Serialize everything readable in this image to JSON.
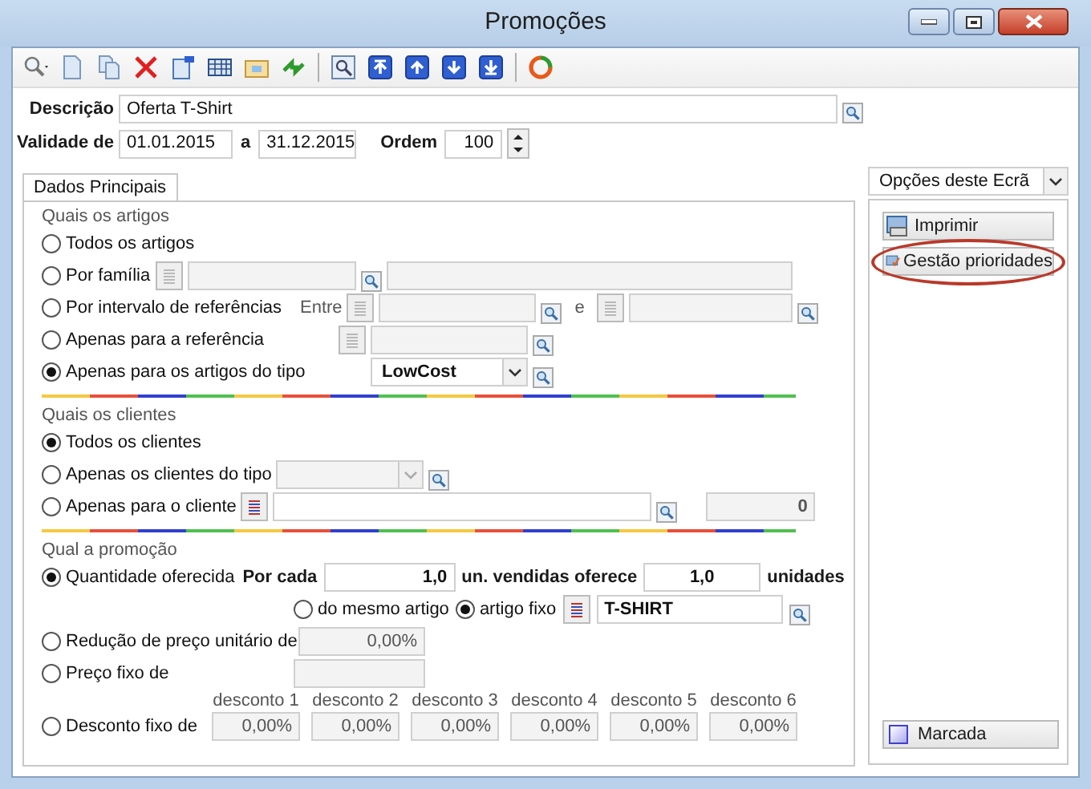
{
  "window": {
    "title": "Promoções"
  },
  "header": {
    "description": {
      "label": "Descrição",
      "value": "Oferta T-Shirt"
    },
    "validity": {
      "label": "Validade de",
      "from": "01.01.2015",
      "separator": "a",
      "to": "31.12.2015"
    },
    "order": {
      "label": "Ordem",
      "value": "100"
    }
  },
  "tabs": [
    {
      "label": "Dados Principais",
      "selected": true
    }
  ],
  "sections": [
    {
      "title": "Quais os artigos",
      "options": [
        {
          "kind": "plain",
          "label": "Todos os artigos",
          "selected": false
        },
        {
          "kind": "family",
          "label": "Por família",
          "selected": false
        },
        {
          "kind": "range",
          "label": "Por intervalo de referências",
          "between_label": "Entre",
          "and_label": "e",
          "selected": false
        },
        {
          "kind": "reference",
          "label": "Apenas para a referência",
          "selected": false
        },
        {
          "kind": "type",
          "label": "Apenas para os artigos do tipo",
          "value": "LowCost",
          "selected": true
        }
      ]
    },
    {
      "title": "Quais os clientes",
      "options": [
        {
          "kind": "plain",
          "label": "Todos os clientes",
          "selected": true
        },
        {
          "kind": "client_type",
          "label": "Apenas os clientes do tipo",
          "selected": false
        },
        {
          "kind": "client",
          "label": "Apenas para o cliente",
          "count": "0",
          "selected": false
        }
      ]
    },
    {
      "title": "Qual a promoção",
      "options": [
        {
          "kind": "quantity",
          "label": "Quantidade oferecida",
          "per_label": "Por cada",
          "per_value": "1,0",
          "sold_label": "un. vendidas oferece",
          "offer_value": "1,0",
          "units_label": "unidades",
          "selected": true,
          "sub_options": [
            {
              "label": "do mesmo artigo",
              "selected": false
            },
            {
              "label": "artigo fixo",
              "selected": true
            }
          ],
          "article": "T-SHIRT"
        },
        {
          "kind": "percent",
          "label": "Redução de preço unitário de",
          "value": "0,00%",
          "selected": false
        },
        {
          "kind": "price",
          "label": "Preço fixo de",
          "selected": false
        },
        {
          "kind": "discounts",
          "label": "Desconto fixo de",
          "selected": false,
          "discounts": [
            {
              "label": "desconto 1",
              "value": "0,00%"
            },
            {
              "label": "desconto 2",
              "value": "0,00%"
            },
            {
              "label": "desconto 3",
              "value": "0,00%"
            },
            {
              "label": "desconto 4",
              "value": "0,00%"
            },
            {
              "label": "desconto 5",
              "value": "0,00%"
            },
            {
              "label": "desconto 6",
              "value": "0,00%"
            }
          ]
        }
      ]
    }
  ],
  "side_panel": {
    "dropdown": "Opções deste Ecrã",
    "options": [
      {
        "label": "Imprimir",
        "highlighted": false
      },
      {
        "label": "Gestão prioridades",
        "highlighted": true
      }
    ],
    "bottom_button": "Marcada"
  }
}
